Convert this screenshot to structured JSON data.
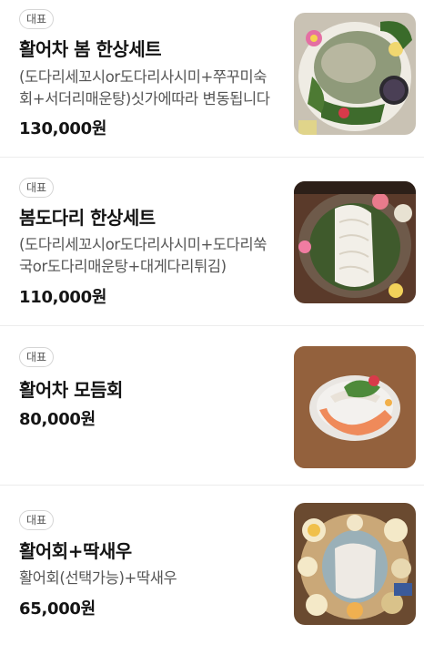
{
  "menu_items": [
    {
      "badge": "대표",
      "name": "활어차 봄 한상세트",
      "description": "(도다리세꼬시or도다리사시미+쭈꾸미숙회+서더리매운탕)싯가에따라 변동됩니다",
      "price": "130,000원",
      "image": "seafood-set-dish-photo"
    },
    {
      "badge": "대표",
      "name": "봄도다리 한상세트",
      "description": "(도다리세꼬시or도다리사시미+도다리쑥국or도다리매운탕+대게다리튀김)",
      "price": "110,000원",
      "image": "flounder-sashimi-platter-photo"
    },
    {
      "badge": "대표",
      "name": "활어차 모듬회",
      "description": "",
      "price": "80,000원",
      "image": "assorted-sashimi-photo"
    },
    {
      "badge": "대표",
      "name": "활어회+딱새우",
      "description": "활어회(선택가능)+딱새우",
      "price": "65,000원",
      "image": "sashimi-with-shrimp-photo"
    }
  ]
}
